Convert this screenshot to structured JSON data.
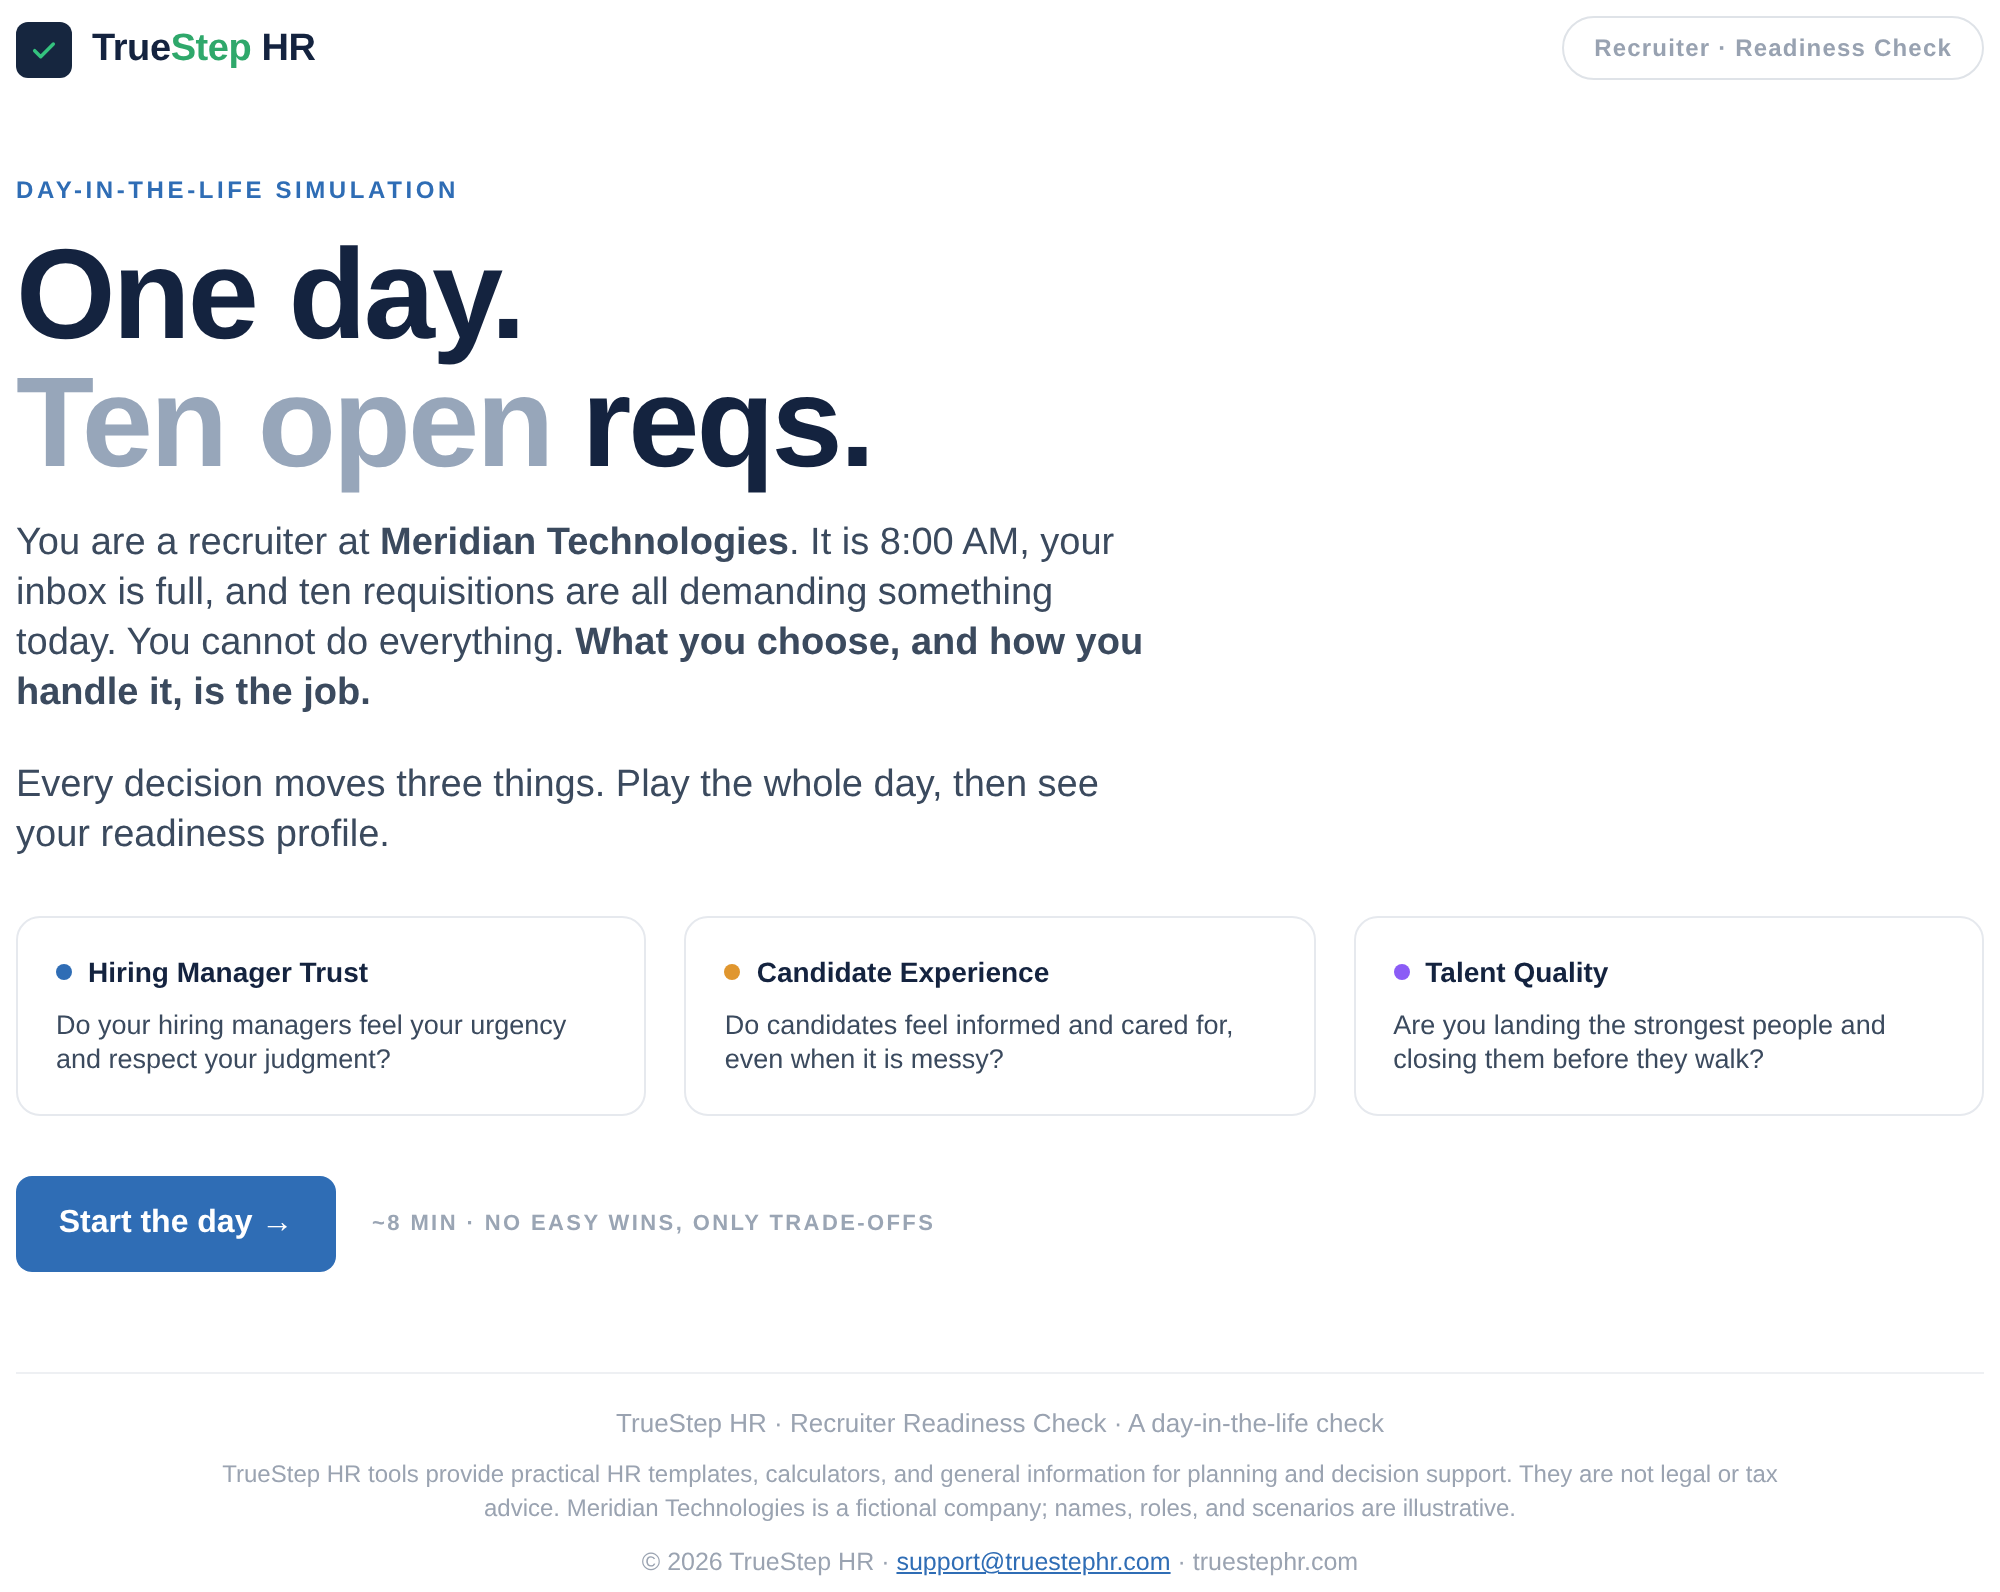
{
  "header": {
    "brand": {
      "prefix": "True",
      "highlight": "Step",
      "suffix": " HR"
    },
    "badge": "Recruiter · Readiness Check"
  },
  "hero": {
    "eyebrow": "DAY-IN-THE-LIFE SIMULATION",
    "headline": [
      {
        "parts": [
          {
            "text": "One day.",
            "muted": false
          }
        ]
      },
      {
        "parts": [
          {
            "text": "Ten open",
            "muted": true
          },
          {
            "text": "reqs.",
            "muted": false
          }
        ]
      }
    ],
    "paragraphs": [
      "You are a recruiter at **Meridian Technologies**. It is 8:00 AM, your inbox is full, and ten requisitions are all demanding something today. You cannot do everything. **What you choose, and how you handle it, is the job.**",
      "Every decision moves three things. Play the whole day, then see your readiness profile."
    ]
  },
  "metrics": [
    {
      "title": "Hiring Manager Trust",
      "text": "Do your hiring managers feel your urgency and respect your judgment?",
      "color": "#2f6db5"
    },
    {
      "title": "Candidate Experience",
      "text": "Do candidates feel informed and cared for, even when it is messy?",
      "color": "#e0962e"
    },
    {
      "title": "Talent Quality",
      "text": "Are you landing the strongest people and closing them before they walk?",
      "color": "#8b5cf6"
    }
  ],
  "cta": {
    "button": "Start the day →",
    "note": "~8 MIN · NO EASY WINS, ONLY TRADE-OFFS"
  },
  "footer": {
    "tagline": "TrueStep HR · Recruiter Readiness Check · A day-in-the-life check",
    "disclaimer": "TrueStep HR tools provide practical HR templates, calculators, and general information for planning and decision support. They are not legal or tax advice. Meridian Technologies is a fictional company; names, roles, and scenarios are illustrative.",
    "copyright": {
      "prefix": "© 2026 TrueStep HR ·",
      "link": "support@truestephr.com",
      "suffix": "· truestephr.com"
    }
  }
}
